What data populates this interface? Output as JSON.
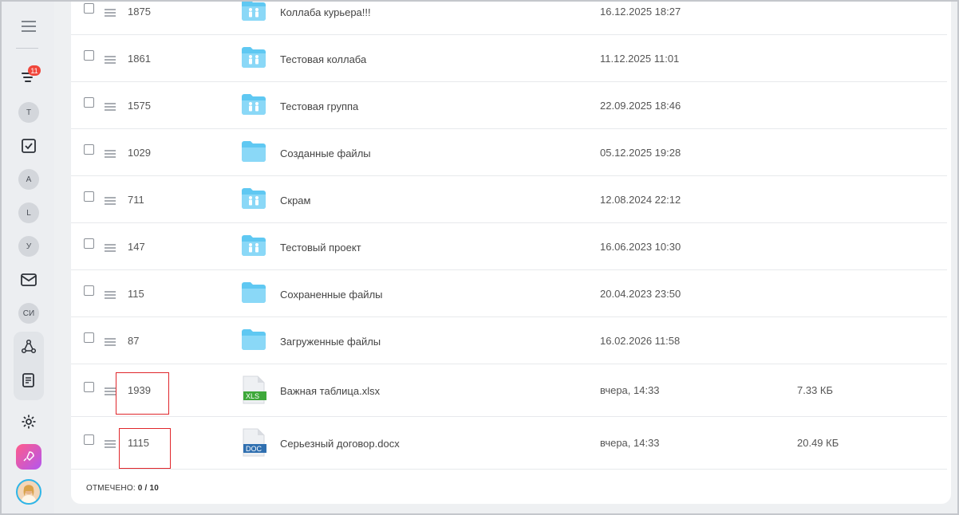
{
  "sidebar": {
    "notifications_badge": "11",
    "items": [
      {
        "name": "menu-icon"
      },
      {
        "name": "feed-icon"
      },
      {
        "letter": "Т"
      },
      {
        "name": "tasks-icon"
      },
      {
        "letter": "А"
      },
      {
        "letter": "L"
      },
      {
        "letter": "У"
      },
      {
        "name": "mail-icon"
      },
      {
        "letter": "СИ"
      },
      {
        "name": "network-icon"
      },
      {
        "name": "document-list-icon"
      },
      {
        "name": "settings-icon"
      },
      {
        "name": "rocket-icon"
      },
      {
        "name": "user-avatar"
      }
    ]
  },
  "rows": [
    {
      "id": "1875",
      "name": "Коллаба курьера!!!",
      "date": "16.12.2025 18:27",
      "size": "",
      "icon": "group-folder-icon"
    },
    {
      "id": "1861",
      "name": "Тестовая коллаба",
      "date": "11.12.2025 11:01",
      "size": "",
      "icon": "group-folder-icon"
    },
    {
      "id": "1575",
      "name": "Тестовая группа",
      "date": "22.09.2025 18:46",
      "size": "",
      "icon": "group-folder-icon"
    },
    {
      "id": "1029",
      "name": "Созданные файлы",
      "date": "05.12.2025 19:28",
      "size": "",
      "icon": "folder-icon"
    },
    {
      "id": "711",
      "name": "Скрам",
      "date": "12.08.2024 22:12",
      "size": "",
      "icon": "group-folder-icon"
    },
    {
      "id": "147",
      "name": "Тестовый проект",
      "date": "16.06.2023 10:30",
      "size": "",
      "icon": "group-folder-icon"
    },
    {
      "id": "115",
      "name": "Сохраненные файлы",
      "date": "20.04.2023 23:50",
      "size": "",
      "icon": "folder-icon"
    },
    {
      "id": "87",
      "name": "Загруженные файлы",
      "date": "16.02.2026 11:58",
      "size": "",
      "icon": "folder-icon"
    },
    {
      "id": "1939",
      "name": "Важная таблица.xlsx",
      "date": "вчера, 14:33",
      "size": "7.33 КБ",
      "icon": "xls-file-icon",
      "file_label": "XLS"
    },
    {
      "id": "1115",
      "name": "Серьезный договор.docx",
      "date": "вчера, 14:33",
      "size": "20.49 КБ",
      "icon": "doc-file-icon",
      "file_label": "DOC"
    }
  ],
  "footer": {
    "label": "ОТМЕЧЕНО:",
    "value": "0 / 10"
  },
  "colors": {
    "folder": "#5fc8f2",
    "folder_light": "#8ad8f7",
    "xls": "#3ea83a",
    "doc": "#2f6fb0",
    "highlight": "#e0262b"
  }
}
